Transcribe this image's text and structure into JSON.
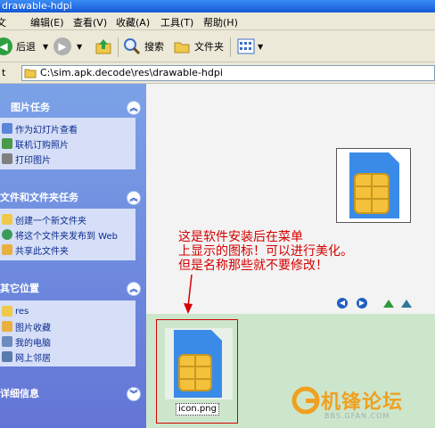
{
  "window": {
    "title": "drawable-hdpi"
  },
  "menu": [
    "编辑(E)",
    "查看(V)",
    "收藏(A)",
    "工具(T)",
    "帮助(H)"
  ],
  "toolbar": {
    "back": "后退",
    "search": "搜索",
    "folders": "文件夹"
  },
  "address": {
    "label": "t",
    "path": "C:\\sim.apk.decode\\res\\drawable-hdpi"
  },
  "sidebar": {
    "picture_tasks": {
      "title": "图片任务",
      "items": [
        "作为幻灯片查看",
        "联机订购照片",
        "打印图片"
      ]
    },
    "file_tasks": {
      "title": "文件和文件夹任务",
      "items": [
        "创建一个新文件夹",
        "将这个文件夹发布到 Web",
        "共享此文件夹"
      ]
    },
    "other_places": {
      "title": "其它位置",
      "items": [
        "res",
        "图片收藏",
        "我的电脑",
        "网上邻居"
      ]
    },
    "details": {
      "title": "详细信息"
    }
  },
  "file": {
    "name": "icon.png"
  },
  "annotation": {
    "lines": [
      "这是软件安装后在菜单",
      "上显示的图标！可以进行美化。",
      "但是名称那些就不要修改！"
    ]
  },
  "watermark": {
    "main": "机锋论坛",
    "sub": "BBS.GFAN.COM"
  },
  "colors": {
    "xp_blue": "#1559d6",
    "sim_blue": "#3a8be8",
    "chip_gold": "#f4c13a",
    "annotation_red": "#d40000",
    "strip_green": "#cce6cc"
  }
}
